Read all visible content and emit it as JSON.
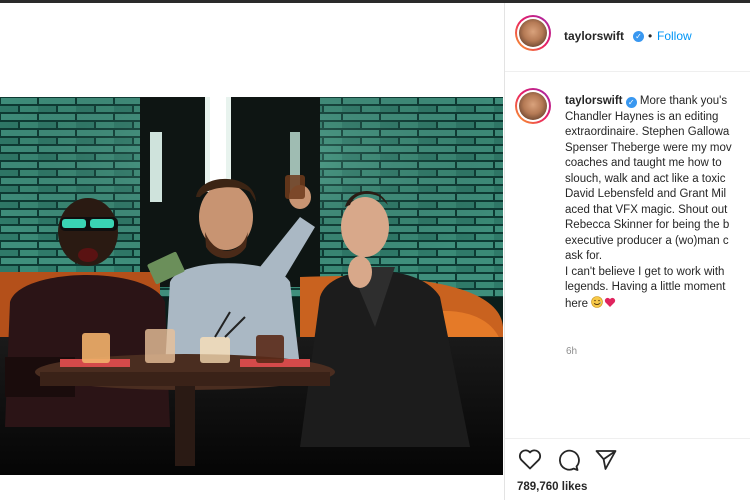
{
  "post": {
    "username": "taylorswift",
    "verified_glyph": "✓",
    "separator": "•",
    "follow_label": "Follow",
    "caption_lines": [
      "More thank you's",
      "Chandler Haynes is an editing",
      "extraordinaire. Stephen Gallowa",
      "Spenser Theberge were my mov",
      "coaches and taught me how to",
      "slouch, walk and act like a toxic",
      "David Lebensfeld and Grant Mil",
      "aced that VFX magic. Shout out",
      "Rebecca Skinner for being the b",
      "executive producer a (wo)man c",
      "ask for.",
      "I can't believe I get to work with",
      "legends. Having a little moment",
      "here"
    ],
    "caption_emojis": [
      "smiling-face-with-tear",
      "red-heart"
    ],
    "time_ago": "6h",
    "likes": "789,760 likes"
  },
  "icons": {
    "like": "heart-icon",
    "comment": "comment-icon",
    "share": "share-icon"
  },
  "colors": {
    "link": "#0095f6",
    "verified": "#3897f0",
    "text": "#262626",
    "muted": "#8e8e8e",
    "heart_emoji": "#e0245e"
  }
}
